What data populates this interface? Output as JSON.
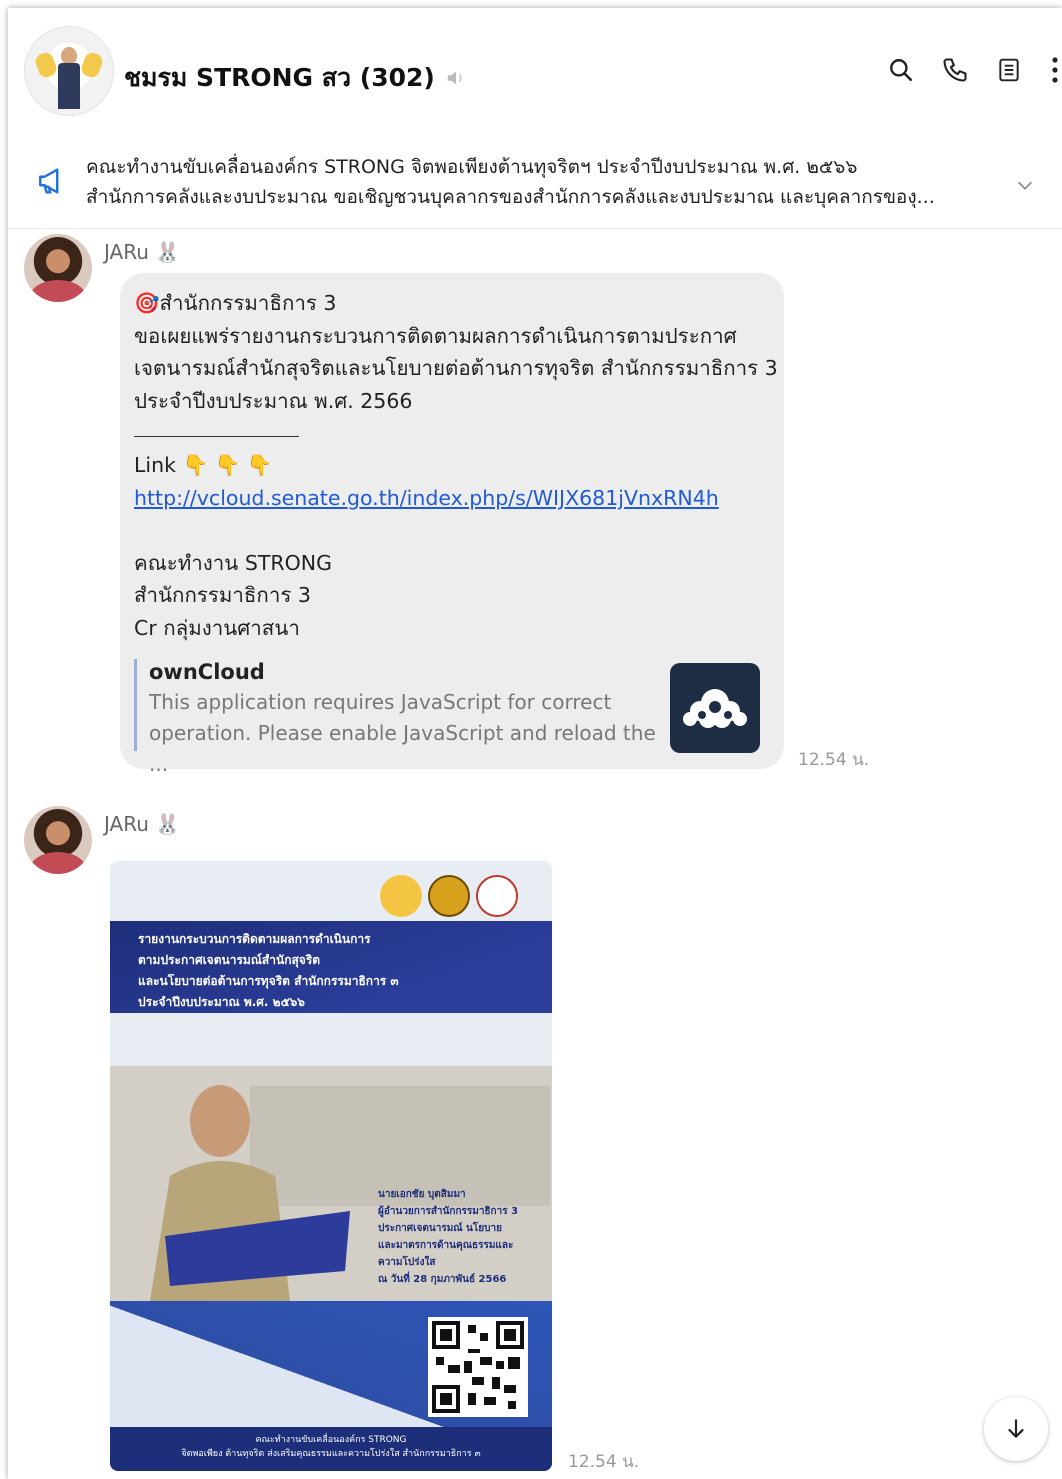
{
  "header": {
    "title": "ชมรม STRONG สว (302)",
    "actions": [
      "search-icon",
      "phone-icon",
      "notes-icon",
      "more-icon"
    ]
  },
  "announcement": {
    "line1": "คณะทำงานขับเคลื่อนองค์กร STRONG จิตพอเพียงต้านทุจริตฯ ประจำปีงบประมาณ พ.ศ. ๒๕๖๖",
    "line2": "สำนักการคลังและงบประมาณ ขอเชิญชวนบุคลากรของสำนักการคลังและงบประมาณ และบุคลากรของุ..."
  },
  "messages": [
    {
      "sender": "JARu",
      "lines": [
        "สำนักกรรมาธิการ 3",
        "ขอเผยแพร่รายงานกระบวนการติดตามผลการดำเนินการตามประกาศ",
        "เจตนารมณ์สำนักสุจริตและนโยบายต่อต้านการทุจริต สำนักกรรมาธิการ 3",
        "ประจำปีงบประมาณ  พ.ศ. 2566"
      ],
      "link_label": "Link",
      "link_url": "http://vcloud.senate.go.th/index.php/s/WIJX681jVnxRN4h",
      "footer_lines": [
        "คณะทำงาน STRONG",
        "สำนักกรรมาธิการ 3",
        "Cr กลุ่มงานศาสนา"
      ],
      "preview": {
        "title": "ownCloud",
        "desc": "This application requires JavaScript for correct operation. Please enable JavaScript and reload the ..."
      },
      "time": "12.54 น."
    },
    {
      "sender": "JARu",
      "poster": {
        "title_lines": [
          "รายงานกระบวนการติดตามผลการดำเนินการ",
          "ตามประกาศเจตนารมณ์สำนักสุจริต",
          "และนโยบายต่อต้านการทุจริต สำนักกรรมาธิการ ๓",
          "ประจำปีงบประมาณ พ.ศ. ๒๕๖๖"
        ],
        "caption_lines": [
          "นายเอกชัย บุตสิมมา",
          "ผู้อำนวยการสำนักกรรมาธิการ 3",
          "ประกาศเจตนารมณ์ นโยบาย",
          "และมาตรการด้านคุณธรรมและ",
          "ความโปร่งใส",
          "ณ วันที่ 28 กุมภาพันธ์ 2566"
        ],
        "footer_lines": [
          "คณะทำงานขับเคลื่อนองค์กร STRONG",
          "จิตพอเพียง ต้านทุจริต ส่งเสริมคุณธรรมและความโปร่งใส สำนักกรรมาธิการ ๓"
        ]
      },
      "time": "12.54 น."
    }
  ]
}
